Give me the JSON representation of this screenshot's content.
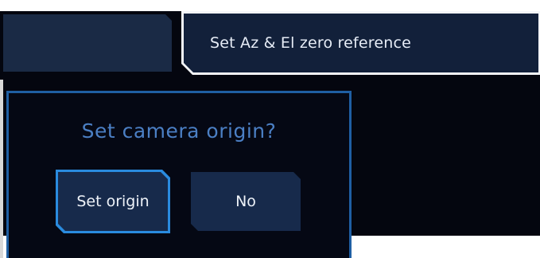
{
  "tabs": {
    "left_label": "",
    "active_label": "Set Az & El zero reference"
  },
  "dialog": {
    "title": "Set camera origin?",
    "primary_label": "Set origin",
    "secondary_label": "No"
  },
  "colors": {
    "background": "#04060f",
    "panel": "#172a4b",
    "accent": "#2a8bdf",
    "title_text": "#4b7fc4",
    "label_text": "#eef2f8",
    "active_tab_border": "#f4f6fa"
  }
}
